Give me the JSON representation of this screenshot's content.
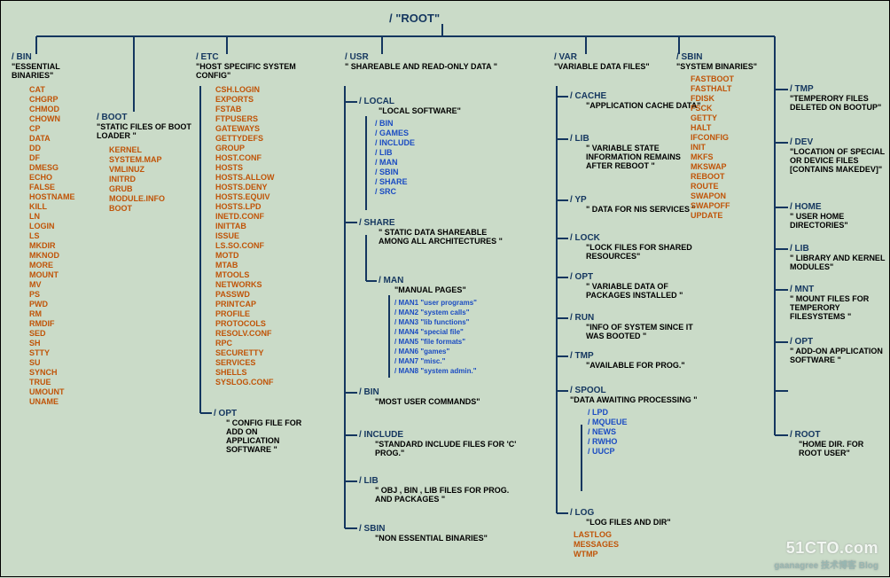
{
  "root": {
    "label": "/  \"ROOT\""
  },
  "bin": {
    "label": "/ BIN",
    "desc": "\"ESSENTIAL BINARIES\"",
    "items": [
      "CAT",
      "CHGRP",
      "CHMOD",
      "CHOWN",
      "CP",
      "DATA",
      "DD",
      "DF",
      "DMESG",
      "ECHO",
      "FALSE",
      "HOSTNAME",
      "KILL",
      "LN",
      "LOGIN",
      "LS",
      "MKDIR",
      "MKNOD",
      "MORE",
      "MOUNT",
      "MV",
      "PS",
      "PWD",
      "RM",
      "RMDIF",
      "SED",
      "SH",
      "STTY",
      "SU",
      "SYNCH",
      "TRUE",
      "UMOUNT",
      "UNAME"
    ]
  },
  "boot": {
    "label": "/ BOOT",
    "desc": "\"STATIC FILES OF BOOT LOADER \"",
    "items": [
      "KERNEL",
      "SYSTEM.MAP",
      "VMLINUZ",
      "INITRD",
      "GRUB",
      "MODULE.INFO",
      "BOOT"
    ]
  },
  "etc": {
    "label": "/ ETC",
    "desc": "\"HOST SPECIFIC SYSTEM CONFIG\"",
    "items": [
      "CSH.LOGIN",
      "EXPORTS",
      "FSTAB",
      "FTPUSERS",
      "GATEWAYS",
      "GETTYDEFS",
      "GROUP",
      "HOST.CONF",
      "HOSTS",
      "HOSTS.ALLOW",
      "HOSTS.DENY",
      "HOSTS.EQUIV",
      "HOSTS.LPD",
      "INETD.CONF",
      "INITTAB",
      "ISSUE",
      "LS.SO.CONF",
      "MOTD",
      "MTAB",
      "MTOOLS",
      "NETWORKS",
      "PASSWD",
      "PRINTCAP",
      "PROFILE",
      "PROTOCOLS",
      "RESOLV.CONF",
      "RPC",
      "SECURETTY",
      "SERVICES",
      "SHELLS",
      "SYSLOG.CONF"
    ]
  },
  "opt_etc": {
    "label": "/ OPT",
    "desc": "\" CONFIG FILE FOR ADD ON APPLICATION SOFTWARE \""
  },
  "usr": {
    "label": "/ USR",
    "desc": "\" SHAREABLE AND READ-ONLY DATA \"",
    "local": {
      "label": "/ LOCAL",
      "desc": "\"LOCAL SOFTWARE\"",
      "items": [
        "/ BIN",
        "/ GAMES",
        "/ INCLUDE",
        "/ LIB",
        "/ MAN",
        "/ SBIN",
        "/ SHARE",
        "/ SRC"
      ]
    },
    "share": {
      "label": "/ SHARE",
      "desc": "\" STATIC DATA SHAREABLE AMONG ALL ARCHITECTURES \"",
      "man": {
        "label": "/ MAN",
        "desc": "\"MANUAL PAGES\"",
        "items": [
          "/ MAN1 \"user programs\"",
          "/ MAN2 \"system calls\"",
          "/ MAN3 \"lib functions\"",
          "/ MAN4 \"special file\"",
          "/ MAN5 \"file formats\"",
          "/ MAN6 \"games\"",
          "/ MAN7 \"misc.\"",
          "/ MAN8 \"system admin.\""
        ]
      }
    },
    "binU": {
      "label": "/ BIN",
      "desc": "\"MOST USER COMMANDS\""
    },
    "include": {
      "label": "/ INCLUDE",
      "desc": "\"STANDARD INCLUDE FILES FOR 'C' PROG.\""
    },
    "libU": {
      "label": "/ LIB",
      "desc": "\" OBJ , BIN , LIB FILES FOR PROG. AND PACKAGES \""
    },
    "sbinU": {
      "label": "/ SBIN",
      "desc": "\"NON ESSENTIAL BINARIES\""
    }
  },
  "var": {
    "label": "/ VAR",
    "desc": "\"VARIABLE DATA FILES\"",
    "cache": {
      "label": "/ CACHE",
      "desc": "\"APPLICATION CACHE DATA\""
    },
    "lib": {
      "label": "/ LIB",
      "desc": "\" VARIABLE STATE INFORMATION REMAINS AFTER REBOOT \""
    },
    "yp": {
      "label": "/ YP",
      "desc": "\" DATA FOR NIS SERVICES \""
    },
    "lock": {
      "label": "/ LOCK",
      "desc": "\"LOCK FILES FOR SHARED RESOURCES\""
    },
    "opt": {
      "label": "/ OPT",
      "desc": "\" VARIABLE DATA OF PACKAGES INSTALLED \""
    },
    "run": {
      "label": "/ RUN",
      "desc": "\"INFO OF SYSTEM SINCE IT WAS BOOTED \""
    },
    "tmp": {
      "label": "/ TMP",
      "desc": "\"AVAILABLE FOR PROG.\""
    },
    "spool": {
      "label": "/ SPOOL",
      "desc": "\"DATA AWAITING PROCESSING \"",
      "items": [
        "/ LPD",
        "/ MQUEUE",
        "/ NEWS",
        "/ RWHO",
        "/ UUCP"
      ]
    },
    "log": {
      "label": "/ LOG",
      "desc": "\"LOG FILES AND DIR\"",
      "items": [
        "LASTLOG",
        "MESSAGES",
        "WTMP"
      ]
    }
  },
  "sbin": {
    "label": "/ SBIN",
    "desc": "\"SYSTEM BINARIES\"",
    "items": [
      "FASTBOOT",
      "FASTHALT",
      "FDISK",
      "FSCK",
      "GETTY",
      "HALT",
      "IFCONFIG",
      "INIT",
      "MKFS",
      "MKSWAP",
      "REBOOT",
      "ROUTE",
      "SWAPON",
      "SWAPOFF",
      "UPDATE"
    ]
  },
  "tmp": {
    "label": "/ TMP",
    "desc": "\"TEMPERORY FILES DELETED ON BOOTUP\""
  },
  "dev": {
    "label": "/ DEV",
    "desc": "\"LOCATION OF SPECIAL OR DEVICE FILES [CONTAINS MAKEDEV]\""
  },
  "home": {
    "label": "/ HOME",
    "desc": "\" USER HOME DIRECTORIES\""
  },
  "libR": {
    "label": "/ LIB",
    "desc": "\" LIBRARY AND KERNEL MODULES\""
  },
  "mnt": {
    "label": "/ MNT",
    "desc": "\"  MOUNT FILES FOR TEMPERORY FILESYSTEMS \""
  },
  "optR": {
    "label": "/ OPT",
    "desc": "\" ADD-ON APPLICATION SOFTWARE \""
  },
  "rootD": {
    "label": "/ ROOT",
    "desc": "\"HOME DIR. FOR ROOT USER\""
  },
  "watermark": {
    "brand": "51CTO.com",
    "sub": "gaanagree 技术博客 Blog"
  }
}
